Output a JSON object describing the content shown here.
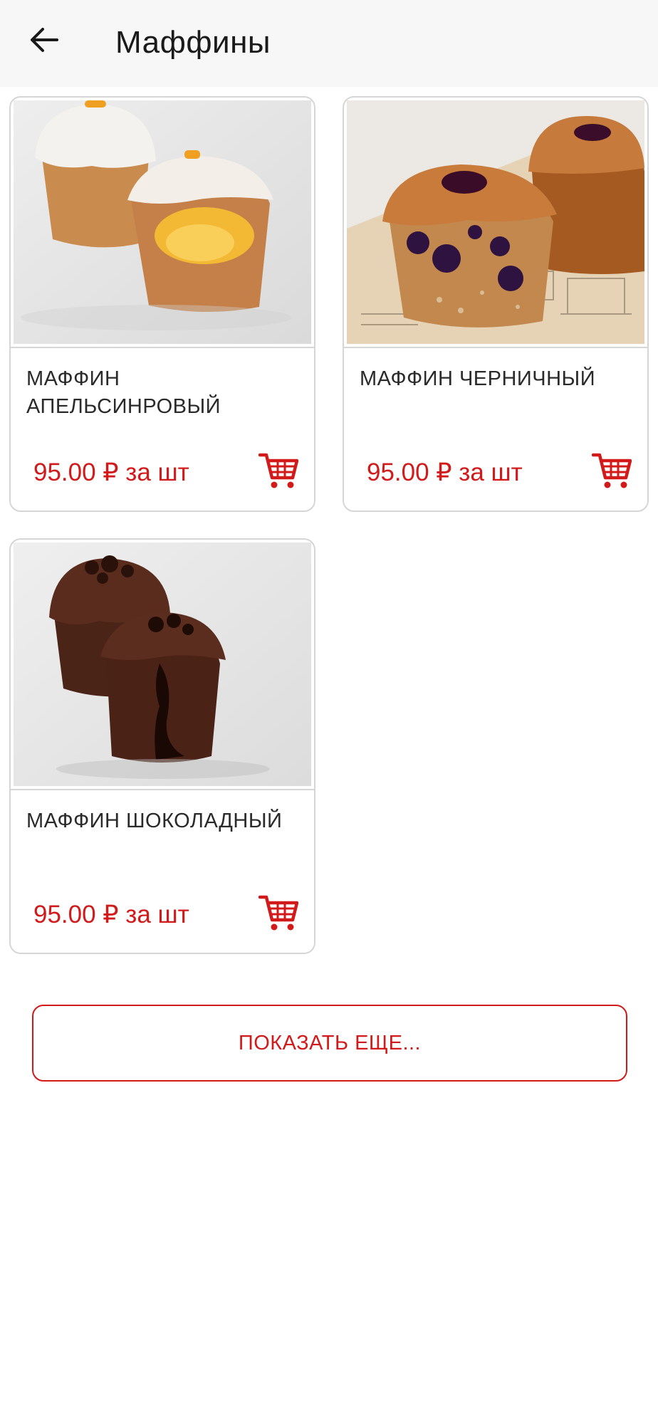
{
  "header": {
    "back_icon": "arrow-left-icon",
    "title": "Маффины"
  },
  "products": [
    {
      "name": "МАФФИН АПЕЛЬСИНРОВЫЙ",
      "price": "95.00 ₽ за шт",
      "image": "orange-muffin-photo",
      "cart_icon": "shopping-cart-icon"
    },
    {
      "name": "МАФФИН ЧЕРНИЧНЫЙ",
      "price": "95.00 ₽ за шт",
      "image": "blueberry-muffin-photo",
      "cart_icon": "shopping-cart-icon"
    },
    {
      "name": "МАФФИН ШОКОЛАДНЫЙ",
      "price": "95.00 ₽ за шт",
      "image": "chocolate-muffin-photo",
      "cart_icon": "shopping-cart-icon"
    }
  ],
  "show_more_label": "ПОКАЗАТЬ ЕЩЕ...",
  "colors": {
    "accent": "#d21a1a",
    "appbar_background": "#f7f7f7",
    "card_border": "#d6d6d6"
  }
}
